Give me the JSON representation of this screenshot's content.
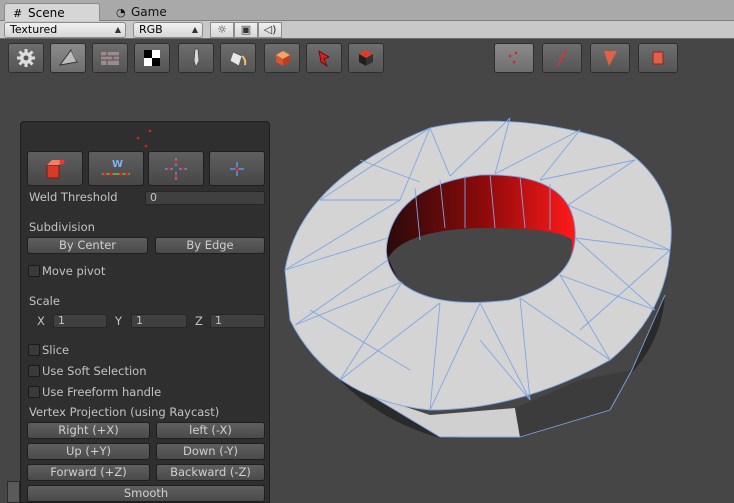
{
  "tabs": [
    {
      "label": "Scene",
      "icon": "hash-icon",
      "active": true
    },
    {
      "label": "Game",
      "icon": "pacman-icon",
      "active": false
    }
  ],
  "toolbar": {
    "shading_mode": "Textured",
    "render_mode": "RGB",
    "buttons": [
      "sun-icon",
      "image-icon",
      "speaker-icon"
    ]
  },
  "tools": [
    {
      "name": "settings",
      "icon": "gear-icon"
    },
    {
      "name": "shape",
      "icon": "pyramid-icon",
      "selected": true
    },
    {
      "name": "texture",
      "icon": "brick-icon"
    },
    {
      "name": "uv",
      "icon": "checker-icon"
    },
    {
      "name": "smoothing",
      "icon": "pen-icon"
    },
    {
      "name": "vertex-color",
      "icon": "paint-bucket-icon"
    },
    {
      "name": "cube-paint",
      "icon": "orange-cube-icon"
    },
    {
      "name": "select-color",
      "icon": "red-cursor-icon"
    },
    {
      "name": "object",
      "icon": "dark-cube-icon"
    }
  ],
  "select_modes": [
    {
      "name": "vertex",
      "icon": "vertex-icon",
      "selected": true
    },
    {
      "name": "edge",
      "icon": "edge-icon"
    },
    {
      "name": "face",
      "icon": "face-icon"
    },
    {
      "name": "element",
      "icon": "element-icon"
    }
  ],
  "panel": {
    "action_buttons": [
      "extrude-icon",
      "weld-icon",
      "split-icon",
      "collapse-icon"
    ],
    "weld_threshold_label": "Weld Threshold",
    "weld_threshold_value": "0",
    "subdivision_label": "Subdivision",
    "by_center": "By Center",
    "by_edge": "By Edge",
    "move_pivot": "Move pivot",
    "scale_label": "Scale",
    "x_label": "X",
    "y_label": "Y",
    "z_label": "Z",
    "x_value": "1",
    "y_value": "1",
    "z_value": "1",
    "slice": "Slice",
    "soft_selection": "Use Soft Selection",
    "freeform_handle": "Use Freeform handle",
    "vertex_projection": "Vertex Projection (using Raycast)",
    "right": "Right (+X)",
    "left": "left (-X)",
    "up": "Up (+Y)",
    "down": "Down (-Y)",
    "forward": "Forward (+Z)",
    "backward": "Backward (-Z)",
    "smooth": "Smooth"
  }
}
